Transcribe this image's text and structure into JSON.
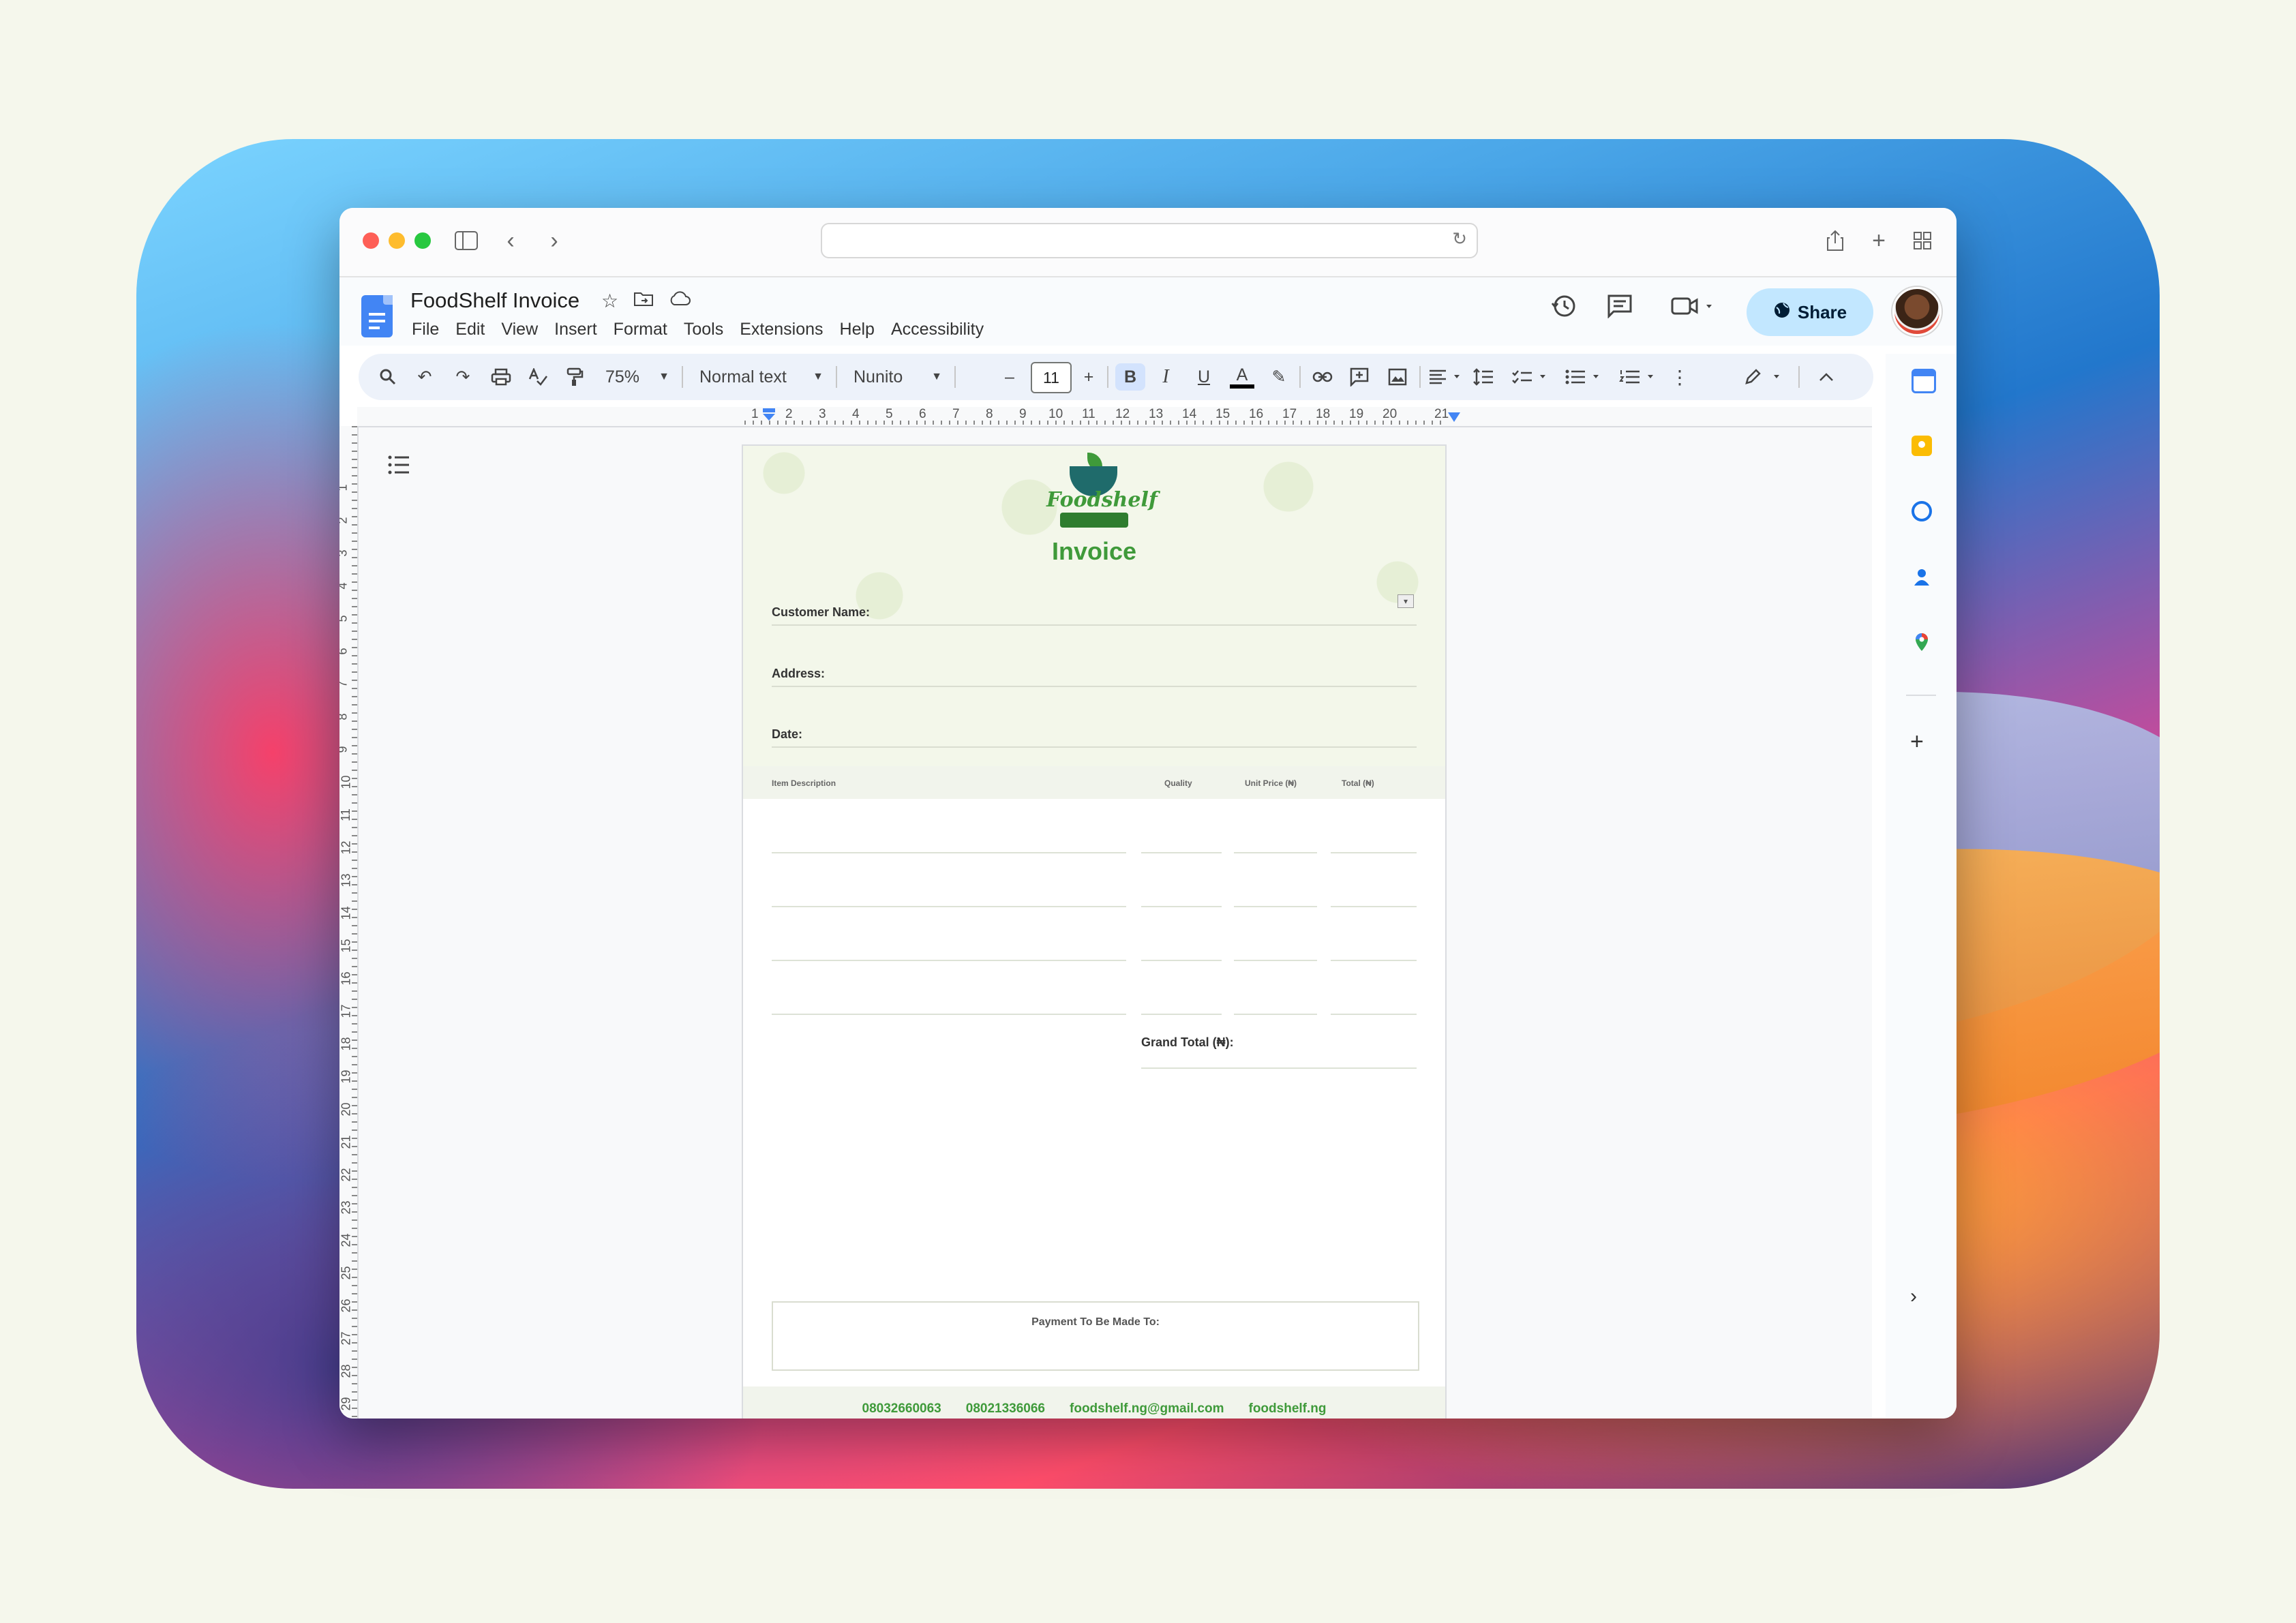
{
  "browser": {
    "back": "‹",
    "forward": "›"
  },
  "doc": {
    "title": "FoodShelf Invoice",
    "menu": [
      "File",
      "Edit",
      "View",
      "Insert",
      "Format",
      "Tools",
      "Extensions",
      "Help",
      "Accessibility"
    ],
    "share_label": "Share"
  },
  "toolbar": {
    "zoom": "75%",
    "style": "Normal text",
    "font": "Nunito",
    "size": "11",
    "minus": "–",
    "plus": "+",
    "bold": "B",
    "italic": "I",
    "underline": "U",
    "text_color": "A"
  },
  "ruler": {
    "h_numbers": [
      "1",
      "2",
      "3",
      "4",
      "5",
      "6",
      "7",
      "8",
      "9",
      "10",
      "11",
      "12",
      "13",
      "14",
      "15",
      "16",
      "17",
      "18",
      "19",
      "20",
      "21"
    ],
    "v_numbers": [
      "1",
      "2",
      "3",
      "4",
      "5",
      "6",
      "7",
      "8",
      "9",
      "10",
      "11",
      "12",
      "13",
      "14",
      "15",
      "16",
      "17",
      "18",
      "19",
      "20",
      "21",
      "22",
      "23",
      "24",
      "25",
      "26",
      "27",
      "28",
      "29"
    ]
  },
  "invoice": {
    "logo_text": "Foodshelf",
    "heading": "Invoice",
    "customer_label": "Customer Name:",
    "address_label": "Address:",
    "date_label": "Date:",
    "table_headers": {
      "item": "Item Description",
      "quantity": "Quality",
      "unit_price": "Unit Price (₦)",
      "total": "Total (₦)"
    },
    "grand_total_label": "Grand Total (₦):",
    "payment_label": "Payment To Be Made To:",
    "footer": [
      "08032660063",
      "08021336066",
      "foodshelf.ng@gmail.com",
      "foodshelf.ng"
    ]
  },
  "colors": {
    "brand_green": "#3f9a3a",
    "share_bg": "#c2e7ff",
    "toolbar_bg": "#edf2fa"
  },
  "side_panel": {
    "icons": [
      "calendar-icon",
      "keep-icon",
      "tasks-icon",
      "contacts-icon",
      "maps-icon"
    ],
    "add": "+",
    "collapse": "›"
  }
}
